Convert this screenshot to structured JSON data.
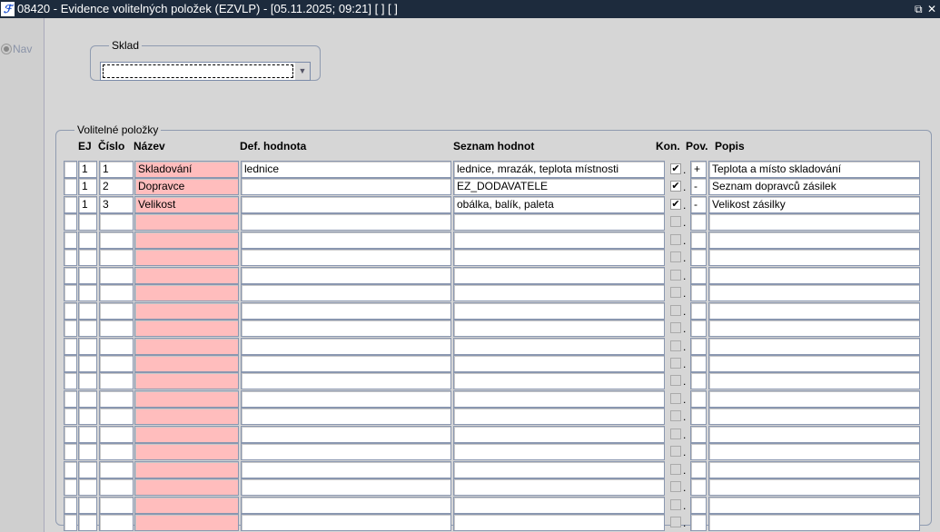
{
  "window": {
    "icon": "app-logo-icon",
    "app_icon_text": "ℱ",
    "title": "08420 - Evidence volitelných položek (EZVLP) - [05.11.2025; 09:21]  [ ]  [ ]",
    "restore_glyph": "⧉",
    "close_glyph": "✕"
  },
  "nav": {
    "label": "Nav"
  },
  "sklad": {
    "legend": "Sklad",
    "value": ""
  },
  "items": {
    "legend": "Volitelné položky",
    "headers": {
      "ej": "EJ",
      "cislo": "Číslo",
      "nazev": "Název",
      "def": "Def. hodnota",
      "seznam": "Seznam hodnot",
      "kon": "Kon.",
      "pov": "Pov.",
      "popis": "Popis"
    },
    "rows": [
      {
        "ej": "1",
        "cislo": "1",
        "nazev": "Skladování",
        "def": "lednice",
        "seznam": "lednice, mrazák, teplota místnosti",
        "kon": true,
        "pov": "+",
        "popis": "Teplota a místo skladování"
      },
      {
        "ej": "1",
        "cislo": "2",
        "nazev": "Dopravce",
        "def": "",
        "seznam": "EZ_DODAVATELE",
        "kon": true,
        "pov": "-",
        "popis": "Seznam dopravců zásilek"
      },
      {
        "ej": "1",
        "cislo": "3",
        "nazev": "Velikost",
        "def": "",
        "seznam": "obálka, balík, paleta",
        "kon": true,
        "pov": "-",
        "popis": "Velikost zásilky"
      }
    ],
    "total_rows": 21
  }
}
